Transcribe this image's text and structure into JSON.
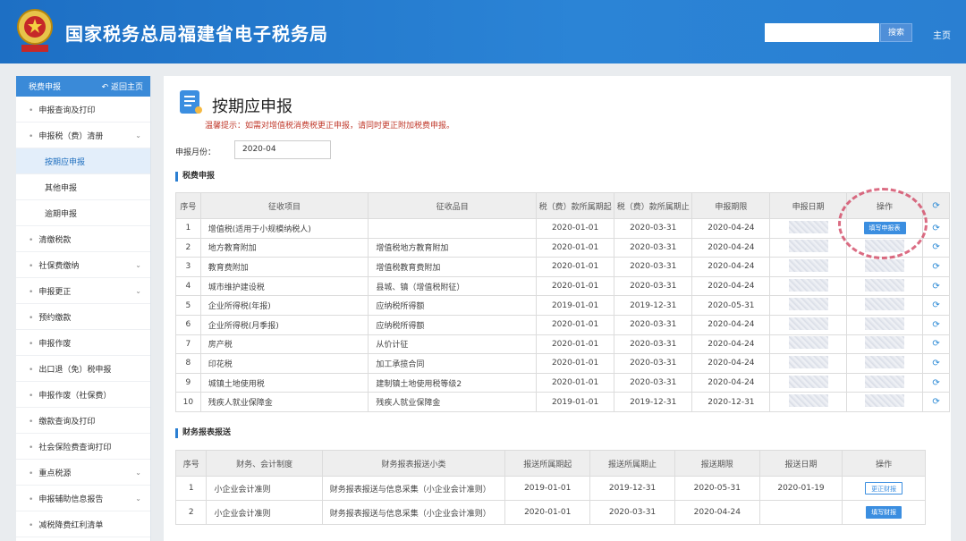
{
  "header": {
    "title": "国家税务总局福建省电子税务局",
    "search_button": "搜索",
    "home": "主页"
  },
  "sidebar": {
    "head": "税费申报",
    "back": "返回主页",
    "items": [
      {
        "label": "申报查询及打印",
        "chev": false,
        "sub": false
      },
      {
        "label": "申报税（费）清册",
        "chev": true,
        "sub": false
      },
      {
        "label": "按期应申报",
        "sub": true,
        "active": true
      },
      {
        "label": "其他申报",
        "sub": true
      },
      {
        "label": "逾期申报",
        "sub": true
      },
      {
        "label": "清缴税款",
        "chev": false
      },
      {
        "label": "社保费缴纳",
        "chev": true
      },
      {
        "label": "申报更正",
        "chev": true
      },
      {
        "label": "预约缴款",
        "chev": false
      },
      {
        "label": "申报作废",
        "chev": false
      },
      {
        "label": "出口退（免）税申报",
        "chev": false
      },
      {
        "label": "申报作废（社保费）",
        "chev": false
      },
      {
        "label": "缴款查询及打印",
        "chev": false
      },
      {
        "label": "社会保险费查询打印",
        "chev": false
      },
      {
        "label": "重点税源",
        "chev": true
      },
      {
        "label": "申报辅助信息报告",
        "chev": true
      },
      {
        "label": "减税降费红利清单",
        "chev": false
      }
    ]
  },
  "main": {
    "title": "按期应申报",
    "tip": "温馨提示：如需对增值税消费税更正申报，请同时更正附加税费申报。",
    "month_label": "申报月份：",
    "month_value": "2020-04",
    "tax_section": "税费申报",
    "tax_headers": [
      "序号",
      "征收项目",
      "征收品目",
      "税（费）款所属期起",
      "税（费）款所属期止",
      "申报期限",
      "申报日期",
      "操作"
    ],
    "tax_rows": [
      [
        "1",
        "增值税(适用于小规模纳税人)",
        "",
        "2020-01-01",
        "2020-03-31",
        "2020-04-24"
      ],
      [
        "2",
        "地方教育附加",
        "增值税地方教育附加",
        "2020-01-01",
        "2020-03-31",
        "2020-04-24"
      ],
      [
        "3",
        "教育费附加",
        "增值税教育费附加",
        "2020-01-01",
        "2020-03-31",
        "2020-04-24"
      ],
      [
        "4",
        "城市维护建设税",
        "县城、镇（增值税附征）",
        "2020-01-01",
        "2020-03-31",
        "2020-04-24"
      ],
      [
        "5",
        "企业所得税(年报)",
        "应纳税所得额",
        "2019-01-01",
        "2019-12-31",
        "2020-05-31"
      ],
      [
        "6",
        "企业所得税(月季报)",
        "应纳税所得额",
        "2020-01-01",
        "2020-03-31",
        "2020-04-24"
      ],
      [
        "7",
        "房产税",
        "从价计征",
        "2020-01-01",
        "2020-03-31",
        "2020-04-24"
      ],
      [
        "8",
        "印花税",
        "加工承揽合同",
        "2020-01-01",
        "2020-03-31",
        "2020-04-24"
      ],
      [
        "9",
        "城镇土地使用税",
        "建制镇土地使用税等级2",
        "2020-01-01",
        "2020-03-31",
        "2020-04-24"
      ],
      [
        "10",
        "残疾人就业保障金",
        "残疾人就业保障金",
        "2019-01-01",
        "2019-12-31",
        "2020-12-31"
      ]
    ],
    "fill_declare": "填写申报表",
    "fin_section": "财务报表报送",
    "fin_headers": [
      "序号",
      "财务、会计制度",
      "财务报表报送小类",
      "报送所属期起",
      "报送所属期止",
      "报送期限",
      "报送日期",
      "操作"
    ],
    "fin_rows": [
      [
        "1",
        "小企业会计准则",
        "财务报表报送与信息采集（小企业会计准则）",
        "2019-01-01",
        "2019-12-31",
        "2020-05-31",
        "2020-01-19",
        "更正财报"
      ],
      [
        "2",
        "小企业会计准则",
        "财务报表报送与信息采集（小企业会计准则）",
        "2020-01-01",
        "2020-03-31",
        "2020-04-24",
        "",
        "填写财报"
      ]
    ]
  }
}
